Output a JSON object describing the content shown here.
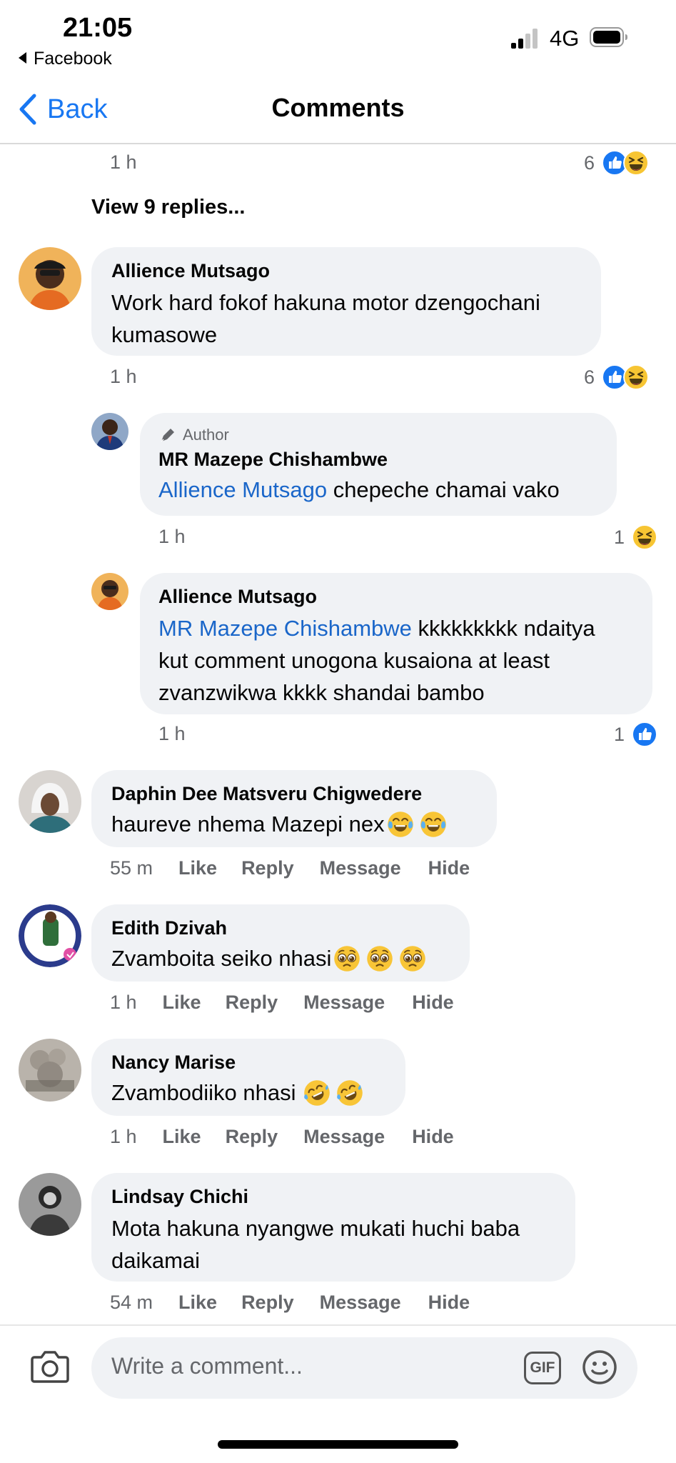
{
  "status_bar": {
    "time": "21:05",
    "back_app": "Facebook",
    "network": "4G"
  },
  "nav": {
    "back_label": "Back",
    "title": "Comments"
  },
  "top_partial": {
    "time": "1 h",
    "reaction_count": "6"
  },
  "view_replies": "View 9 replies...",
  "comment1": {
    "name": "Allience Mutsago",
    "text_line1": "Work hard fokof hakuna motor dzengochani",
    "text_line2": "kumasowe",
    "time": "1 h",
    "reaction_count": "6"
  },
  "reply1": {
    "author_badge": "Author",
    "name": "MR Mazepe Chishambwe",
    "mention": "Allience Mutsago",
    "text": " chepeche chamai vako",
    "time": "1 h",
    "reaction_count": "1"
  },
  "reply2": {
    "name": "Allience Mutsago",
    "mention": "MR Mazepe Chishambwe",
    "text_line1": " kkkkkkkkk ndaitya",
    "text_line2": "kut comment unogona kusaiona at least",
    "text_line3": "zvanzwikwa kkkk shandai bambo",
    "time": "1 h",
    "reaction_count": "1"
  },
  "comment2": {
    "name": "Daphin Dee Matsveru Chigwedere",
    "text": "haureve nhema Mazepi  nex",
    "time": "55 m"
  },
  "comment3": {
    "name": "Edith Dzivah",
    "text": "Zvamboita seiko nhasi",
    "time": "1 h"
  },
  "comment4": {
    "name": "Nancy Marise",
    "text": "Zvambodiiko nhasi ",
    "time": "1 h"
  },
  "comment5": {
    "name": "Lindsay Chichi",
    "text_line1": "Mota hakuna nyangwe mukati huchi baba",
    "text_line2": "daikamai",
    "time": "54 m"
  },
  "actions": {
    "like": "Like",
    "reply": "Reply",
    "message": "Message",
    "hide": "Hide"
  },
  "composer": {
    "placeholder": "Write a comment...",
    "gif_label": "GIF"
  },
  "icons": [
    "chevron-left-icon",
    "signal-icon",
    "battery-icon",
    "like-reaction-icon",
    "haha-reaction-icon",
    "pen-icon",
    "camera-icon",
    "gif-icon",
    "smiley-icon",
    "tears-of-joy-emoji",
    "pleading-face-emoji",
    "rolling-laughing-emoji"
  ],
  "colors": {
    "accent": "#1877f2",
    "mention": "#1a66c9",
    "bubble": "#f0f2f5",
    "meta": "#65676b",
    "like_blue": "#1877f2",
    "haha_yellow": "#f7c533"
  }
}
